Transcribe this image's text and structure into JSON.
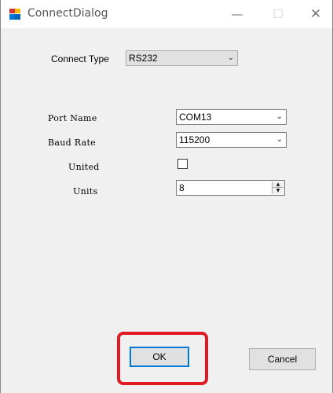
{
  "window": {
    "title": "ConnectDialog",
    "minimize": "—",
    "maximize": "☐",
    "close": "✕"
  },
  "connect_type": {
    "label": "Connect Type",
    "value": "RS232",
    "arrow": "⌄"
  },
  "port_name": {
    "label": "Port Name",
    "value": "COM13",
    "arrow": "⌄"
  },
  "baud_rate": {
    "label": "Baud Rate",
    "value": "115200",
    "arrow": "⌄"
  },
  "united": {
    "label": "United",
    "checked": false
  },
  "units": {
    "label": "Units",
    "value": "8",
    "up": "▲",
    "down": "▼"
  },
  "buttons": {
    "ok": "OK",
    "cancel": "Cancel"
  },
  "colors": {
    "highlight": "#e01b24",
    "default_button_border": "#0078d7"
  }
}
